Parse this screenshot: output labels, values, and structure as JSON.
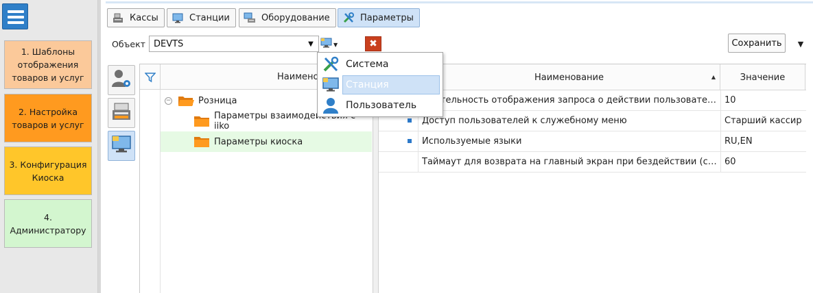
{
  "sidebar": {
    "tiles": [
      {
        "label": "1. Шаблоны отображения товаров и услуг"
      },
      {
        "label": "2. Настройка товаров и услуг"
      },
      {
        "label": "3. Конфигурация Киоска"
      },
      {
        "label": "4. Администратору"
      }
    ]
  },
  "tabs": [
    {
      "label": "Кассы",
      "icon": "cash-register-icon"
    },
    {
      "label": "Станции",
      "icon": "monitor-icon"
    },
    {
      "label": "Оборудование",
      "icon": "equipment-icon"
    },
    {
      "label": "Параметры",
      "icon": "tools-icon",
      "active": true
    }
  ],
  "object": {
    "label": "Объект",
    "value": "DEVTS"
  },
  "toolbar": {
    "save_label": "Сохранить"
  },
  "tree": {
    "header": "Наименование",
    "rows": [
      {
        "label": "Розница",
        "level": 0
      },
      {
        "label": "Параметры взаимодействия с iiko",
        "level": 1
      },
      {
        "label": "Параметры киоска",
        "level": 1,
        "selected": true
      }
    ]
  },
  "grid": {
    "col_name": "Наименование",
    "col_value": "Значение",
    "rows": [
      {
        "name": "Длительность отображения запроса о действии пользователя (секунды)",
        "value": "10"
      },
      {
        "name": "Доступ пользователей к служебному меню",
        "value": "Старший кассир"
      },
      {
        "name": "Используемые языки",
        "value": "RU,EN"
      },
      {
        "name": "Таймаут для возврата на главный экран при бездействии (секунды)",
        "value": "60"
      }
    ]
  },
  "popup": {
    "items": [
      {
        "label": "Система",
        "icon": "tools-icon"
      },
      {
        "label": "Станция",
        "icon": "monitor-icon",
        "hover": true
      },
      {
        "label": "Пользователь",
        "icon": "user-icon"
      }
    ]
  },
  "colors": {
    "accent": "#2f7fc8",
    "tile1": "#fbc99a",
    "tile2": "#ff9a1f",
    "tile3": "#ffc62a",
    "tile4": "#d3f6cf",
    "clear_button": "#c9401e",
    "selection": "#cfe2f7"
  }
}
